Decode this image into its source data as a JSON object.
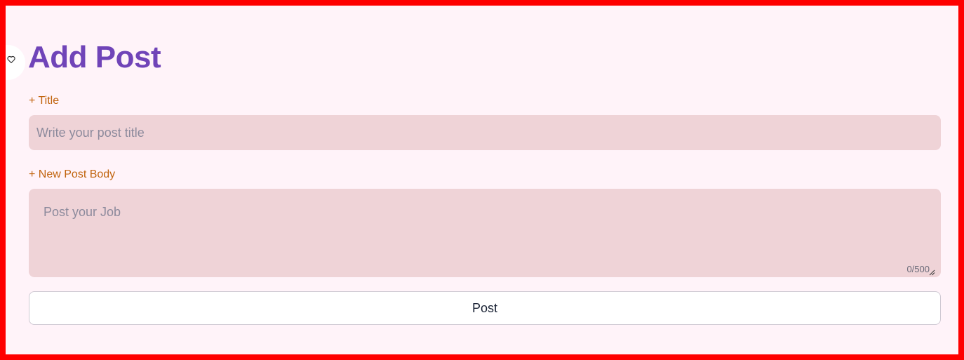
{
  "page": {
    "title": "Add Post"
  },
  "form": {
    "title_label": "+ Title",
    "title_placeholder": "Write your post title",
    "title_value": "",
    "body_label": "+ New Post Body",
    "body_placeholder": "Post your Job",
    "body_value": "",
    "char_counter": "0/500",
    "submit_label": "Post"
  },
  "icons": {
    "side_bubble": "heart-icon",
    "resize": "resize-handle-icon"
  },
  "colors": {
    "border": "#ff0000",
    "background": "#fff3f9",
    "title": "#7044b8",
    "label": "#c1640e",
    "input_fill": "#efd3d7"
  }
}
